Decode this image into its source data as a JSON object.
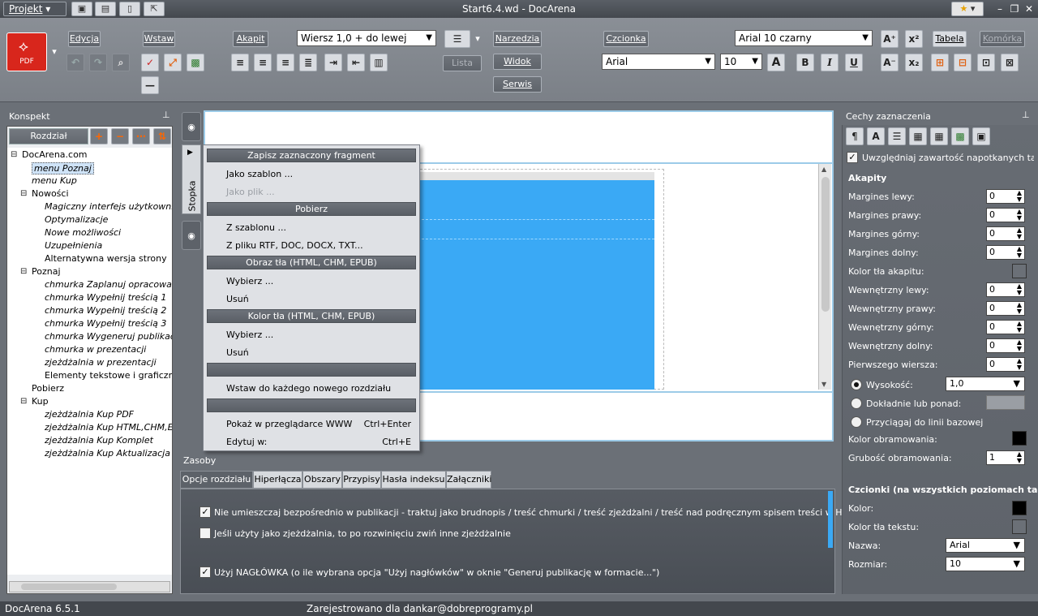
{
  "titlebar": {
    "title": "Start6.4.wd - DocArena",
    "project_label": "Projekt",
    "min": "–",
    "restore": "❐",
    "close": "✕"
  },
  "ribbon": {
    "pdf_label": "PDF",
    "edycja": "Edycja",
    "wstaw": "Wstaw",
    "akapit": "Akapit",
    "paragraph_style": "Wiersz 1,0 + do lewej",
    "lista": "Lista",
    "narzedzia": "Narzedzia",
    "widok": "Widok",
    "serwis": "Serwis",
    "czcionka": "Czcionka",
    "font_style": "Arial 10 czarny",
    "font_name": "Arial",
    "font_size": "10",
    "tabela": "Tabela",
    "komorka": "Komórka",
    "bold": "B",
    "italic": "I",
    "underline": "U",
    "grow_font": "A"
  },
  "outline": {
    "header": "Konspekt",
    "rozdzial": "Rozdział",
    "items": [
      {
        "label": "DocArena.com",
        "italic": false,
        "level": 0,
        "box": "⊟"
      },
      {
        "label": "menu Poznaj",
        "italic": true,
        "level": 1,
        "selected": true
      },
      {
        "label": "menu Kup",
        "italic": true,
        "level": 1
      },
      {
        "label": "Nowości",
        "italic": false,
        "level": 1,
        "box": "⊟"
      },
      {
        "label": "Magiczny interfejs użytkownika",
        "italic": true,
        "level": 2
      },
      {
        "label": "Optymalizacje",
        "italic": true,
        "level": 2
      },
      {
        "label": "Nowe możliwości",
        "italic": true,
        "level": 2
      },
      {
        "label": "Uzupełnienia",
        "italic": true,
        "level": 2
      },
      {
        "label": "Alternatywna wersja strony",
        "italic": false,
        "level": 2
      },
      {
        "label": "Poznaj",
        "italic": false,
        "level": 1,
        "box": "⊟"
      },
      {
        "label": "chmurka Zaplanuj opracowanie",
        "italic": true,
        "level": 2
      },
      {
        "label": "chmurka Wypełnij treścią 1",
        "italic": true,
        "level": 2
      },
      {
        "label": "chmurka Wypełnij treścią 2",
        "italic": true,
        "level": 2
      },
      {
        "label": "chmurka Wypełnij treścią 3",
        "italic": true,
        "level": 2
      },
      {
        "label": "chmurka Wygeneruj publikację",
        "italic": true,
        "level": 2
      },
      {
        "label": "chmurka w prezentacji",
        "italic": true,
        "level": 2
      },
      {
        "label": "zjeżdżalnia w prezentacji",
        "italic": true,
        "level": 2
      },
      {
        "label": "Elementy tekstowe i graficzne",
        "italic": false,
        "level": 2
      },
      {
        "label": "Pobierz",
        "italic": false,
        "level": 1
      },
      {
        "label": "Kup",
        "italic": false,
        "level": 1,
        "box": "⊟"
      },
      {
        "label": "zjeżdżalnia Kup PDF",
        "italic": true,
        "level": 2
      },
      {
        "label": "zjeżdżalnia Kup HTML,CHM,EPUB",
        "italic": true,
        "level": 2
      },
      {
        "label": "zjeżdżalnia Kup Komplet",
        "italic": true,
        "level": 2
      },
      {
        "label": "zjeżdżalnia Kup Aktualizacja",
        "italic": true,
        "level": 2
      }
    ]
  },
  "side": {
    "stopka": "Stopka"
  },
  "menu": {
    "h1": "Zapisz zaznaczony fragment",
    "jako_szablon": "Jako szablon ...",
    "jako_plik": "Jako plik ...",
    "h2": "Pobierz",
    "z_szablonu": "Z szablonu ...",
    "z_pliku": "Z pliku RTF, DOC, DOCX, TXT...",
    "h3": "Obraz tła (HTML, CHM, EPUB)",
    "wybierz1": "Wybierz ...",
    "usun1": "Usuń",
    "h4": "Kolor tła (HTML, CHM, EPUB)",
    "wybierz2": "Wybierz ...",
    "usun2": "Usuń",
    "wstaw_do": "Wstaw do każdego nowego rozdziału",
    "pokaz": "Pokaż w przeglądarce WWW",
    "pokaz_sc": "Ctrl+Enter",
    "edytuj": "Edytuj w:",
    "edytuj_sc": "Ctrl+E"
  },
  "resources": {
    "header": "Zasoby",
    "tabs": [
      "Opcje rozdziału",
      "Hiperłącza",
      "Obszary",
      "Przypisy",
      "Hasła indeksu",
      "Załączniki"
    ],
    "opt1": "Nie umieszczaj bezpośrednio w publikacji - traktuj jako brudnopis / treść chmurki / treść zjeżdżalni / treść nad podręcznym spisem treści w HTML",
    "opt2": "Jeśli użyty jako zjeżdżalnia, to po rozwinięciu zwiń inne zjeżdżalnie",
    "opt3": "Użyj NAGŁÓWKA (o ile wybrana opcja \"Użyj nagłówków\" w oknie \"Generuj publikację w formacie...\")"
  },
  "props": {
    "header": "Cechy zaznaczenia",
    "include": "Uwzględniaj zawartość napotkanych tabel",
    "akapity": "Akapity",
    "fields": [
      {
        "label": "Margines lewy:",
        "value": "0"
      },
      {
        "label": "Margines prawy:",
        "value": "0"
      },
      {
        "label": "Margines górny:",
        "value": "0"
      },
      {
        "label": "Margines dolny:",
        "value": "0"
      }
    ],
    "kolor_tla": "Kolor tła akapitu:",
    "inner": [
      {
        "label": "Wewnętrzny lewy:",
        "value": "0"
      },
      {
        "label": "Wewnętrzny prawy:",
        "value": "0"
      },
      {
        "label": "Wewnętrzny górny:",
        "value": "0"
      },
      {
        "label": "Wewnętrzny dolny:",
        "value": "0"
      },
      {
        "label": "Pierwszego wiersza:",
        "value": "0"
      }
    ],
    "wysokosc": "Wysokość:",
    "wysokosc_val": "1,0",
    "dokladnie": "Dokładnie lub ponad:",
    "przyciagaj": "Przyciągaj do linii bazowej",
    "kolor_obr": "Kolor obramowania:",
    "grubosc": "Grubość obramowania:",
    "grubosc_val": "1",
    "czcionki": "Czcionki (na wszystkich poziomach tabel)",
    "kolor": "Kolor:",
    "kolor_tekstu": "Kolor tła tekstu:",
    "nazwa": "Nazwa:",
    "nazwa_val": "Arial",
    "rozmiar": "Rozmiar:",
    "rozmiar_val": "10"
  },
  "status": {
    "version": "DocArena 6.5.1",
    "registered": "Zarejestrowano dla dankar@dobreprogramy.pl"
  },
  "colors": {
    "accent_blue": "#3aa9f5",
    "pdf_red": "#d8261c"
  }
}
